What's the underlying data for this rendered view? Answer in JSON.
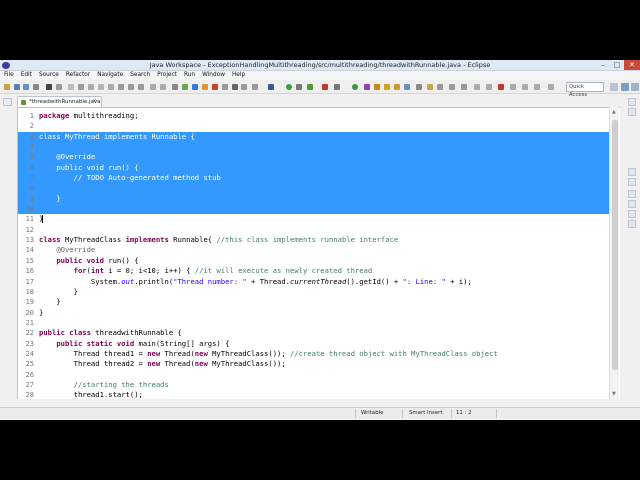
{
  "window": {
    "title": "Java Workspace - ExceptionHandlingMultithreading/src/multithreading/threadwithRunnable.java - Eclipse",
    "controls": {
      "minimize": "–",
      "maximize": "□",
      "close": "✕"
    }
  },
  "menu": {
    "items": [
      "File",
      "Edit",
      "Source",
      "Refactor",
      "Navigate",
      "Search",
      "Project",
      "Run",
      "Window",
      "Help"
    ]
  },
  "toolbar": {
    "quick_access_placeholder": "Quick Access"
  },
  "editor": {
    "tab_label": "*threadwithRunnable.java",
    "tab_close": "✕",
    "lines": [
      {
        "n": "1",
        "sel": false,
        "seg": [
          {
            "t": "package ",
            "c": "kw"
          },
          {
            "t": "multithreading;",
            "c": ""
          }
        ]
      },
      {
        "n": "2",
        "sel": false,
        "seg": []
      },
      {
        "n": "3",
        "sel": true,
        "seg": [
          {
            "t": "class MyThread implements Runnable {",
            "c": ""
          }
        ]
      },
      {
        "n": "4",
        "sel": true,
        "seg": []
      },
      {
        "n": "5",
        "sel": true,
        "seg": [
          {
            "t": "    @Override",
            "c": ""
          }
        ]
      },
      {
        "n": "6",
        "sel": true,
        "seg": [
          {
            "t": "    public void run() {",
            "c": ""
          }
        ]
      },
      {
        "n": "7",
        "sel": true,
        "seg": [
          {
            "t": "        // TODO Auto-generated method stub",
            "c": ""
          }
        ]
      },
      {
        "n": "8",
        "sel": true,
        "seg": []
      },
      {
        "n": "9",
        "sel": true,
        "seg": [
          {
            "t": "    }",
            "c": ""
          }
        ]
      },
      {
        "n": "10",
        "sel": true,
        "seg": []
      },
      {
        "n": "11",
        "sel": false,
        "seg": [
          {
            "t": "}",
            "c": ""
          }
        ],
        "cursor": true
      },
      {
        "n": "12",
        "sel": false,
        "seg": []
      },
      {
        "n": "13",
        "sel": false,
        "seg": [
          {
            "t": "class ",
            "c": "kw"
          },
          {
            "t": "MyThreadClass ",
            "c": ""
          },
          {
            "t": "implements ",
            "c": "kw"
          },
          {
            "t": "Runnable{ ",
            "c": ""
          },
          {
            "t": "//this class implements runnable interface",
            "c": "cm"
          }
        ]
      },
      {
        "n": "14",
        "sel": false,
        "seg": [
          {
            "t": "    ",
            "c": ""
          },
          {
            "t": "@Override",
            "c": "an"
          }
        ]
      },
      {
        "n": "15",
        "sel": false,
        "seg": [
          {
            "t": "    ",
            "c": ""
          },
          {
            "t": "public void ",
            "c": "kw"
          },
          {
            "t": "run() {",
            "c": ""
          }
        ]
      },
      {
        "n": "16",
        "sel": false,
        "seg": [
          {
            "t": "        ",
            "c": ""
          },
          {
            "t": "for",
            "c": "kw"
          },
          {
            "t": "(",
            "c": ""
          },
          {
            "t": "int ",
            "c": "kw"
          },
          {
            "t": "i = 0; i<10; i++) { ",
            "c": ""
          },
          {
            "t": "//it will execute as newly created thread",
            "c": "cm"
          }
        ]
      },
      {
        "n": "17",
        "sel": false,
        "seg": [
          {
            "t": "            System.",
            "c": ""
          },
          {
            "t": "out",
            "c": "st it"
          },
          {
            "t": ".println(",
            "c": ""
          },
          {
            "t": "\"Thread number: \"",
            "c": "st"
          },
          {
            "t": " + Thread.",
            "c": ""
          },
          {
            "t": "currentThread",
            "c": "it"
          },
          {
            "t": "().getId() + ",
            "c": ""
          },
          {
            "t": "\": Line: \"",
            "c": "st"
          },
          {
            "t": " + i);",
            "c": ""
          }
        ]
      },
      {
        "n": "18",
        "sel": false,
        "seg": [
          {
            "t": "        }",
            "c": ""
          }
        ]
      },
      {
        "n": "19",
        "sel": false,
        "seg": [
          {
            "t": "    }",
            "c": ""
          }
        ]
      },
      {
        "n": "20",
        "sel": false,
        "seg": [
          {
            "t": "}",
            "c": ""
          }
        ]
      },
      {
        "n": "21",
        "sel": false,
        "seg": []
      },
      {
        "n": "22",
        "sel": false,
        "seg": [
          {
            "t": "public class ",
            "c": "kw"
          },
          {
            "t": "threadwithRunnable {",
            "c": ""
          }
        ]
      },
      {
        "n": "23",
        "sel": false,
        "seg": [
          {
            "t": "    ",
            "c": ""
          },
          {
            "t": "public static void ",
            "c": "kw"
          },
          {
            "t": "main(String[] args) {",
            "c": ""
          }
        ]
      },
      {
        "n": "24",
        "sel": false,
        "seg": [
          {
            "t": "        Thread thread1 = ",
            "c": ""
          },
          {
            "t": "new ",
            "c": "kw"
          },
          {
            "t": "Thread(",
            "c": ""
          },
          {
            "t": "new ",
            "c": "kw"
          },
          {
            "t": "MyThreadClass()); ",
            "c": ""
          },
          {
            "t": "//create thread object with MyThreadClass object",
            "c": "cm"
          }
        ]
      },
      {
        "n": "25",
        "sel": false,
        "seg": [
          {
            "t": "        Thread thread2 = ",
            "c": ""
          },
          {
            "t": "new ",
            "c": "kw"
          },
          {
            "t": "Thread(",
            "c": ""
          },
          {
            "t": "new ",
            "c": "kw"
          },
          {
            "t": "MyThreadClass());",
            "c": ""
          }
        ]
      },
      {
        "n": "26",
        "sel": false,
        "seg": []
      },
      {
        "n": "27",
        "sel": false,
        "seg": [
          {
            "t": "        ",
            "c": ""
          },
          {
            "t": "//starting the threads",
            "c": "cm"
          }
        ]
      },
      {
        "n": "28",
        "sel": false,
        "seg": [
          {
            "t": "        thread1.start();",
            "c": ""
          }
        ]
      }
    ]
  },
  "status": {
    "mode": "Writable",
    "insert": "Smart Insert",
    "position": "11 : 2"
  },
  "colors": {
    "selection": "#3399ff",
    "keyword": "#7f0055",
    "comment": "#3f7f5f",
    "string": "#2a00ff"
  }
}
